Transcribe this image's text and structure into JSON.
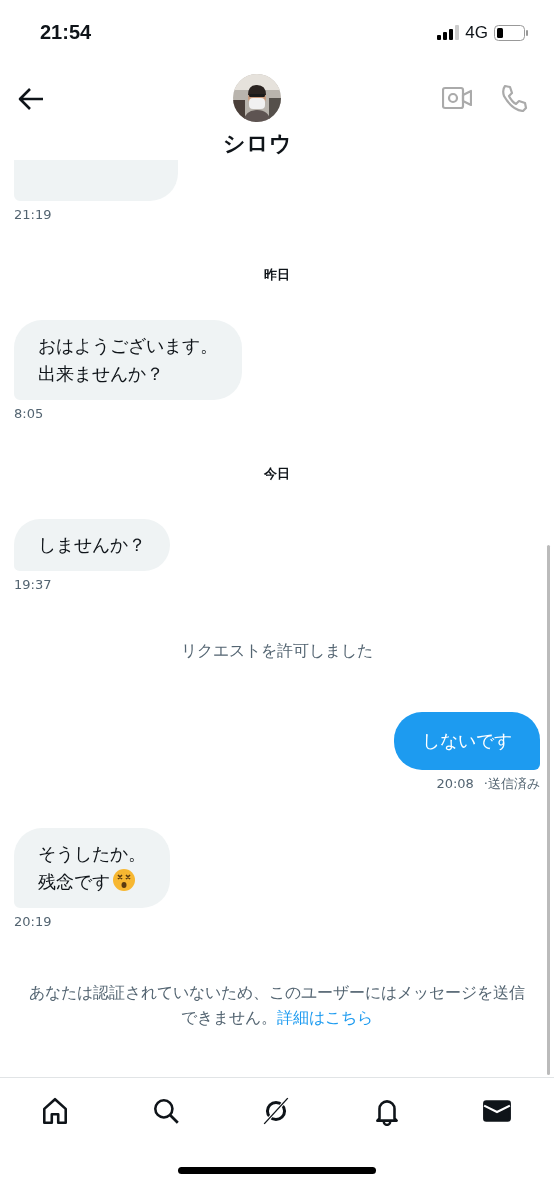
{
  "status_bar": {
    "time": "21:54",
    "network": "4G"
  },
  "header": {
    "name": "シロウ"
  },
  "messages": [
    {
      "kind": "clipped",
      "time": "21:19"
    },
    {
      "kind": "date",
      "text": "昨日"
    },
    {
      "kind": "incoming",
      "lines": [
        "おはようございます。",
        "出来ませんか？"
      ],
      "time": "8:05"
    },
    {
      "kind": "date",
      "text": "今日"
    },
    {
      "kind": "incoming",
      "lines": [
        "しませんか？"
      ],
      "time": "19:37"
    },
    {
      "kind": "system",
      "text": "リクエストを許可しました"
    },
    {
      "kind": "outgoing",
      "lines": [
        "しないです"
      ],
      "time": "20:08",
      "status": "·送信済み"
    },
    {
      "kind": "incoming",
      "lines": [
        "そうしたか。",
        "残念です"
      ],
      "emoji": true,
      "time": "20:19"
    }
  ],
  "notice": {
    "text": "あなたは認証されていないため、このユーザーにはメッセージを送信できません。",
    "link": "詳細はこちら"
  },
  "tabs": [
    {
      "kind": "home",
      "selected": false
    },
    {
      "kind": "search",
      "selected": false
    },
    {
      "kind": "spaces",
      "selected": false
    },
    {
      "kind": "notifications",
      "selected": false
    },
    {
      "kind": "messages",
      "selected": true
    }
  ]
}
